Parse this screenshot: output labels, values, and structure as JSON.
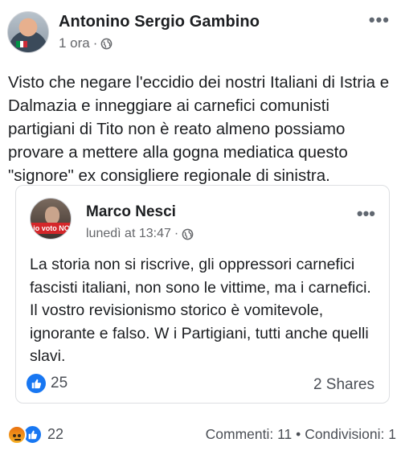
{
  "post": {
    "author": "Antonino Sergio Gambino",
    "time": "1 ora",
    "separator": "·",
    "privacy_icon": "globe-icon",
    "more_icon": "•••",
    "text": "Visto che negare l'eccidio dei nostri Italiani di Istria e Dalmazia e inneggiare ai carnefici comunisti partigiani di Tito non è reato almeno possiamo provare a mettere alla gogna mediatica questo \"signore\" ex consigliere regionale di sinistra."
  },
  "shared_post": {
    "author": "Marco Nesci",
    "time": "lunedì at 13:47",
    "separator": "·",
    "privacy_icon": "globe-icon",
    "more_icon": "•••",
    "avatar_badge": "io voto NO",
    "text": "La storia non si riscrive, gli oppressori carnefici fascisti italiani, non sono le vittime, ma i carnefici. Il vostro revisionismo storico è vomitevole, ignorante e falso. W i Partigiani, tutti anche quelli slavi.",
    "like_count": "25",
    "shares": "2 Shares"
  },
  "footer": {
    "reaction_count": "22",
    "comments": "Commenti: 11",
    "dot": "•",
    "shares": "Condivisioni: 1"
  },
  "colors": {
    "like_blue": "#1877f2",
    "secondary_text": "#65676b",
    "angry_orange": "#e9710f"
  }
}
